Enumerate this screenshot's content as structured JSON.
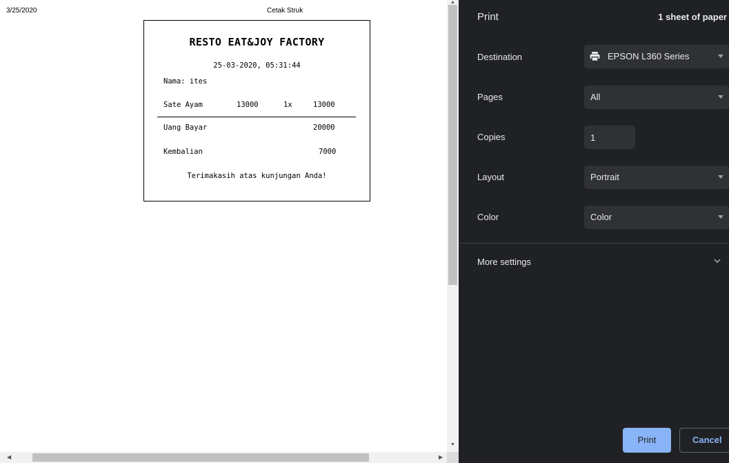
{
  "preview": {
    "header_date": "3/25/2020",
    "header_title": "Cetak Struk",
    "receipt": {
      "title": "RESTO EAT&JOY FACTORY",
      "datetime": "25-03-2020, 05:31:44",
      "customer": "Nama: ites",
      "items": [
        {
          "name": "Sate Ayam",
          "price": "13000",
          "qty": "1x",
          "total": "13000"
        }
      ],
      "paid_label": "Uang Bayar",
      "paid_value": "20000",
      "change_label": "Kembalian",
      "change_value": "7000",
      "footer": "Terimakasih atas kunjungan Anda!"
    }
  },
  "panel": {
    "title": "Print",
    "sheets": "1 sheet of paper",
    "destination": {
      "label": "Destination",
      "value": "EPSON L360 Series",
      "icon": "printer-icon"
    },
    "pages": {
      "label": "Pages",
      "value": "All"
    },
    "copies": {
      "label": "Copies",
      "value": "1"
    },
    "layout": {
      "label": "Layout",
      "value": "Portrait"
    },
    "color": {
      "label": "Color",
      "value": "Color"
    },
    "more_settings": "More settings",
    "print_button": "Print",
    "cancel_button": "Cancel",
    "colors": {
      "background": "#202124",
      "field": "#303134",
      "accent": "#8ab4f8"
    }
  }
}
